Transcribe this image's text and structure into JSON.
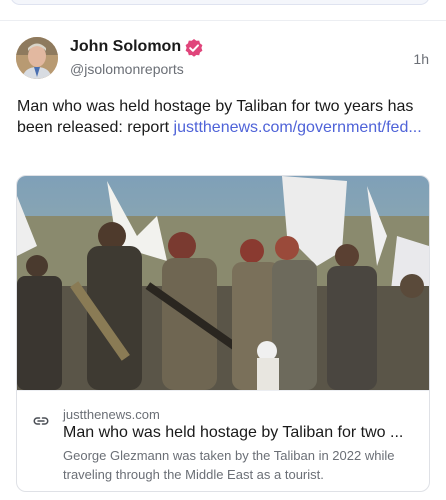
{
  "post": {
    "author_name": "John Solomon",
    "author_handle": "@jsolomonreports",
    "timestamp": "1h",
    "text": "Man who was held hostage by Taliban for two years has been released: report ",
    "link_text": "justthenews.com/government/fed...",
    "avatar_icon": "avatar-photo",
    "verified_icon": "verified-badge-icon",
    "verified_color": "#e0457b"
  },
  "link_card": {
    "domain": "justthenews.com",
    "title": "Man who was held hostage by Taliban for two ...",
    "description": "George Glezmann was taken by the Taliban in 2022 while traveling through the Middle East as a tourist.",
    "link_icon": "link-icon"
  },
  "colors": {
    "link": "#4f63d8",
    "muted_text": "#6b6f76",
    "border": "#dfe1e6"
  }
}
